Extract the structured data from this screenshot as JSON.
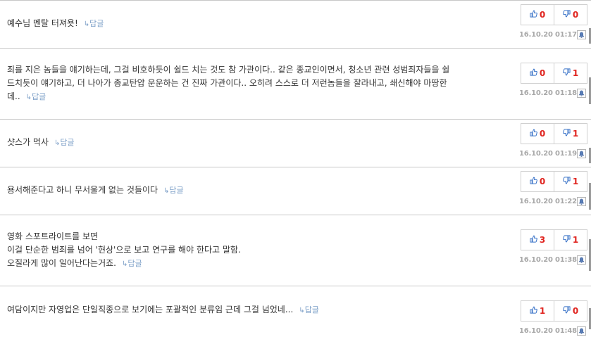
{
  "reply_label": "답글",
  "comments": [
    {
      "lines": [
        "예수님 멘탈 터져욧!"
      ],
      "up": "0",
      "down": "0",
      "time": "16.10.20 01:17"
    },
    {
      "lines": [
        "죄를 지은 놈들을 얘기하는데, 그걸 비호하듯이 쉴드 치는 것도 참 가관이다.. 같은 종교인이면서, 청소년 관련 성범죄자들을 쉴",
        "드치듯이 얘기하고, 더 나아가 종교탄압 운운하는 건 진짜 가관이다.. 오히려 스스로 더 저런놈들을 잘라내고, 쇄신해야 마땅한",
        "데.."
      ],
      "up": "0",
      "down": "1",
      "time": "16.10.20 01:18"
    },
    {
      "lines": [
        "샷스가 먹사"
      ],
      "up": "0",
      "down": "1",
      "time": "16.10.20 01:19"
    },
    {
      "lines": [
        "용서해준다고 하니 무서울게 없는 것들이다"
      ],
      "up": "0",
      "down": "1",
      "time": "16.10.20 01:22"
    },
    {
      "lines": [
        "영화 스포트라이트를 보면",
        "이걸 단순한 범죄를 넘어 '현상'으로 보고 연구를 해야 한다고 말함.",
        "오질라게 많이 일어난다는거죠."
      ],
      "up": "3",
      "down": "1",
      "time": "16.10.20 01:38"
    },
    {
      "lines": [
        "여담이지만 자영업은 단일직종으로 보기에는 포괄적인 분류임 근데 그걸 넘었네..."
      ],
      "up": "1",
      "down": "0",
      "time": "16.10.20 01:48"
    }
  ]
}
